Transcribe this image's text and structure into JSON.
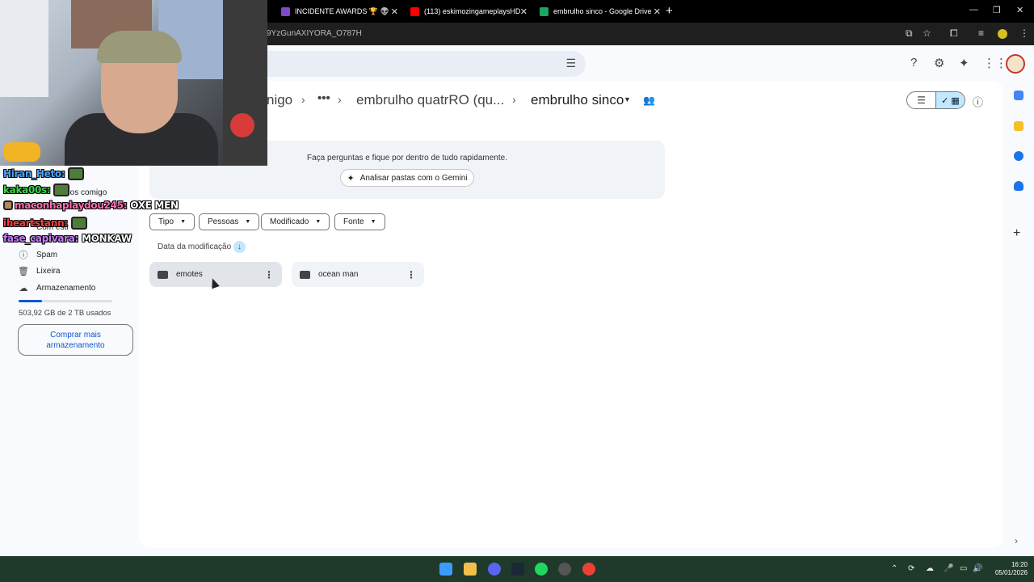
{
  "browser": {
    "tabs": [
      {
        "label": "INCIDENTE AWARDS 🏆 👽",
        "color": "#7b4bc9"
      },
      {
        "label": "(113) eskimozingameplaysHD",
        "color": "#ff0000"
      },
      {
        "label": "embrulho sinco - Google Drive",
        "color": "#1ea362"
      }
    ],
    "url_fragment": "9YzGunAXIYORA_O787H"
  },
  "drive": {
    "breadcrumb": {
      "partial": "nigo",
      "ellipsis": "•••",
      "parent": "embrulho quatrRO (qu...",
      "current": "embrulho sinco"
    },
    "gemini": {
      "prompt": "Faça perguntas e fique por dentro de tudo rapidamente.",
      "button": "Analisar pastas com o Gemini"
    },
    "filters": [
      "Tipo",
      "Pessoas",
      "Modificado",
      "Fonte"
    ],
    "sort_label": "Data da modificação",
    "folders": [
      "emotes",
      "ocean man"
    ],
    "sidebar": {
      "partial_items": [
        "hados comigo",
        "Com estr"
      ],
      "spam": "Spam",
      "trash": "Lixeira",
      "storage": "Armazenamento",
      "storage_used_text": "503,92 GB de 2 TB usados",
      "storage_fraction": 0.25,
      "buy_line1": "Comprar mais",
      "buy_line2": "armazenamento"
    }
  },
  "chat": [
    {
      "user": "Hiran_Heto:",
      "color": "#4aa3ff",
      "msg": ""
    },
    {
      "user": "kaka00s:",
      "color": "#3fd14a",
      "msg": ""
    },
    {
      "user": "maconhaplaydou245:",
      "color": "#ff6eb4",
      "msg": "OXE MEN"
    },
    {
      "user": "iheartstann:",
      "color": "#ff3b3b",
      "msg": ""
    },
    {
      "user": "fase_capivara:",
      "color": "#c77dff",
      "msg": "MONKAW"
    }
  ],
  "taskbar": {
    "time": "16:20",
    "date": "05/01/2026"
  }
}
